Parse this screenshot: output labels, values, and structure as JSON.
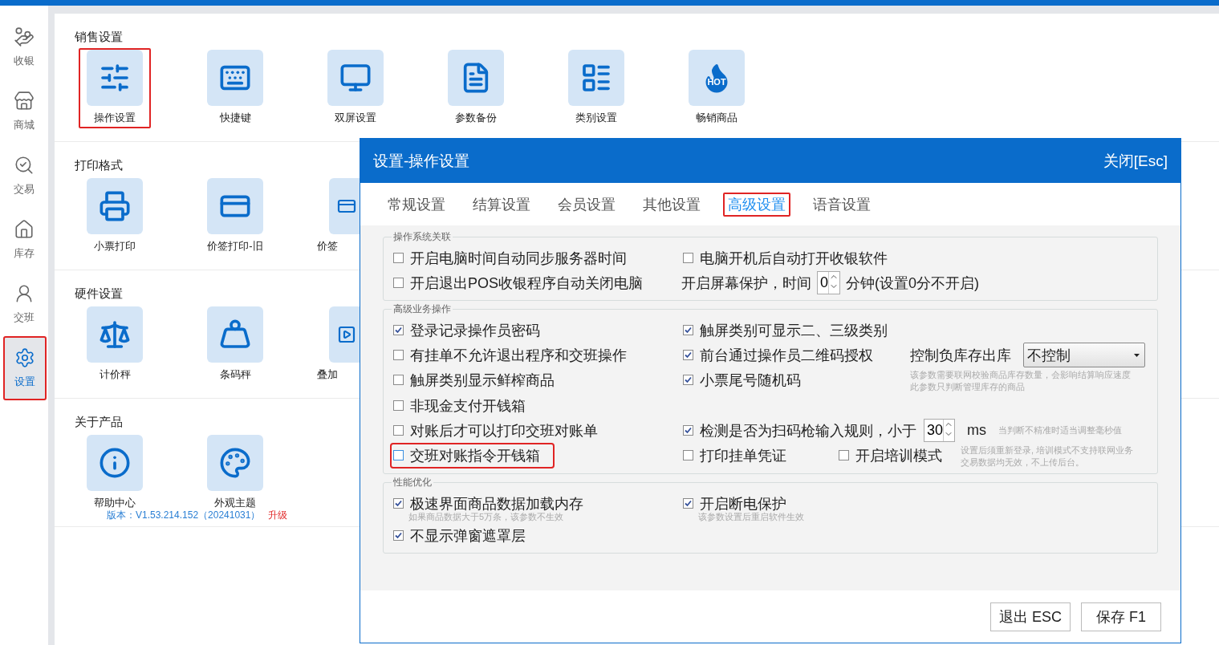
{
  "sidebar": {
    "items": [
      {
        "label": "收银",
        "selected": false,
        "highlighted": false
      },
      {
        "label": "商城",
        "selected": false,
        "highlighted": false
      },
      {
        "label": "交易",
        "selected": false,
        "highlighted": false
      },
      {
        "label": "库存",
        "selected": false,
        "highlighted": false
      },
      {
        "label": "交班",
        "selected": false,
        "highlighted": false
      },
      {
        "label": "设置",
        "selected": true,
        "highlighted": true
      }
    ]
  },
  "sections": [
    {
      "title": "销售设置",
      "tiles": [
        {
          "label": "操作设置",
          "kind": "full",
          "highlighted": true
        },
        {
          "label": "快捷键",
          "kind": "full",
          "highlighted": false
        },
        {
          "label": "双屏设置",
          "kind": "full",
          "highlighted": false
        },
        {
          "label": "参数备份",
          "kind": "full",
          "highlighted": false
        },
        {
          "label": "类别设置",
          "kind": "full",
          "highlighted": false
        },
        {
          "label": "畅销商品",
          "kind": "full",
          "highlighted": false,
          "badge": "HOT"
        }
      ]
    },
    {
      "title": "打印格式",
      "tiles": [
        {
          "label": "小票打印",
          "kind": "full",
          "highlighted": false
        },
        {
          "label": "价签打印-旧",
          "kind": "full",
          "highlighted": false
        },
        {
          "label": "价签",
          "kind": "partial",
          "highlighted": false
        }
      ]
    },
    {
      "title": "硬件设置",
      "tiles": [
        {
          "label": "计价秤",
          "kind": "full",
          "highlighted": false
        },
        {
          "label": "条码秤",
          "kind": "full",
          "highlighted": false
        },
        {
          "label": "叠加",
          "kind": "partial",
          "highlighted": false
        }
      ]
    },
    {
      "title": "关于产品",
      "tiles": [
        {
          "label": "帮助中心",
          "kind": "full",
          "highlighted": false
        },
        {
          "label": "外观主题",
          "kind": "full",
          "highlighted": false
        }
      ]
    }
  ],
  "version": {
    "text": "版本：V1.53.214.152（20241031）",
    "link": "升级"
  },
  "dialog": {
    "title": "设置-操作设置",
    "close": "关闭[Esc]",
    "tabs": [
      {
        "label": "常规设置",
        "selected": false,
        "highlighted": false
      },
      {
        "label": "结算设置",
        "selected": false,
        "highlighted": false
      },
      {
        "label": "会员设置",
        "selected": false,
        "highlighted": false
      },
      {
        "label": "其他设置",
        "selected": false,
        "highlighted": false
      },
      {
        "label": "高级设置",
        "selected": true,
        "highlighted": true
      },
      {
        "label": "语音设置",
        "selected": false,
        "highlighted": false
      }
    ],
    "groups": [
      {
        "legend": "操作系统关联",
        "rows": [
          [
            {
              "kind": "checkbox",
              "label": "开启电脑时间自动同步服务器时间",
              "checked": false,
              "highlighted": false
            },
            {
              "kind": "checkbox",
              "label": "电脑开机后自动打开收银软件",
              "checked": false,
              "highlighted": false
            }
          ],
          [
            {
              "kind": "checkbox",
              "label": "开启退出POS收银程序自动关闭电脑",
              "checked": false,
              "highlighted": false
            },
            {
              "kind": "spinner",
              "label": "开启屏幕保护，时间",
              "value": "0",
              "unit": "分钟(设置0分不开启)"
            }
          ]
        ]
      },
      {
        "legend": "高级业务操作",
        "rows": [
          [
            {
              "kind": "checkbox",
              "label": "登录记录操作员密码",
              "checked": true,
              "highlighted": false
            },
            {
              "kind": "checkbox",
              "label": "触屏类别可显示二、三级类别",
              "checked": true,
              "highlighted": false
            }
          ],
          [
            {
              "kind": "checkbox",
              "label": "有挂单不允许退出程序和交班操作",
              "checked": false,
              "highlighted": false
            },
            {
              "kind": "checkbox",
              "label": "前台通过操作员二维码授权",
              "checked": true,
              "highlighted": false
            },
            {
              "kind": "select",
              "label": "控制负库存出库",
              "value": "不控制"
            }
          ],
          [
            {
              "kind": "checkbox",
              "label": "触屏类别显示鲜榨商品",
              "checked": false,
              "highlighted": false
            },
            {
              "kind": "checkbox",
              "label": "小票尾号随机码",
              "checked": true,
              "highlighted": false
            },
            {
              "kind": "hint",
              "lines": [
                "该参数需要联网校验商品库存数量，会影响结算响应速度",
                "此参数只判断管理库存的商品"
              ]
            }
          ],
          [
            {
              "kind": "checkbox",
              "label": "非现金支付开钱箱",
              "checked": false,
              "highlighted": false
            }
          ],
          [
            {
              "kind": "checkbox",
              "label": "对账后才可以打印交班对账单",
              "checked": false,
              "highlighted": false
            },
            {
              "kind": "check-spinner",
              "label": "检测是否为扫码枪输入规则，小于",
              "checked": true,
              "value": "30",
              "unit": "ms",
              "hint": "当判断不精准时适当调整毫秒值"
            }
          ],
          [
            {
              "kind": "checkbox",
              "label": "交班对账指令开钱箱",
              "checked": false,
              "highlighted": true
            },
            {
              "kind": "checkbox",
              "label": "打印挂单凭证",
              "checked": false,
              "highlighted": false
            },
            {
              "kind": "checkbox",
              "label": "开启培训模式",
              "checked": false,
              "highlighted": false
            },
            {
              "kind": "hint",
              "lines": [
                "设置后须重新登录, 培训模式不支持联网业务",
                "交易数据均无效，不上传后台。"
              ]
            }
          ]
        ]
      },
      {
        "legend": "性能优化",
        "rows": [
          [
            {
              "kind": "checkbox",
              "label": "极速界面商品数据加载内存",
              "checked": true,
              "highlighted": false,
              "note": "如果商品数据大于5万条，该参数不生效"
            },
            {
              "kind": "checkbox",
              "label": "开启断电保护",
              "checked": true,
              "highlighted": false,
              "note": "该参数设置后重启软件生效"
            }
          ],
          [
            {
              "kind": "checkbox",
              "label": "不显示弹窗遮罩层",
              "checked": true,
              "highlighted": false
            }
          ]
        ]
      }
    ],
    "buttons": [
      "退出 ESC",
      "保存 F1"
    ]
  }
}
